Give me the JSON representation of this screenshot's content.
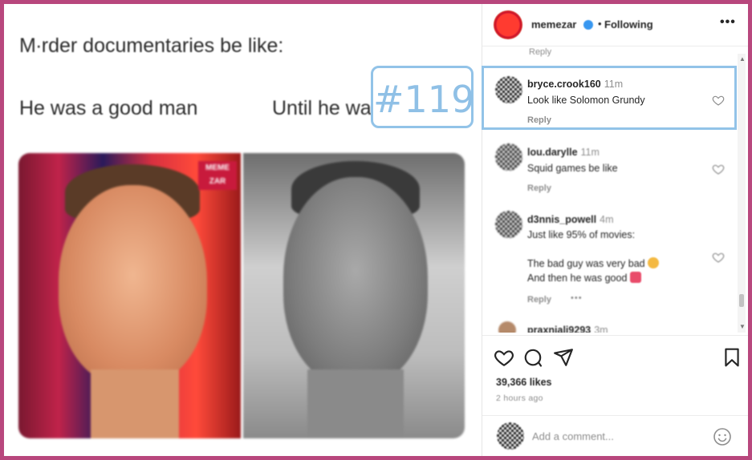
{
  "post": {
    "tweet_line1": "M∙rder documentaries be like:",
    "tweet_left": "He was a good man",
    "tweet_right": "Until he wa",
    "brand_tag_top": "MEME",
    "brand_tag_bottom": "ZAR"
  },
  "overlay": {
    "label": "#119"
  },
  "header": {
    "username": "memezar",
    "separator": "•",
    "follow_status": "Following",
    "more": "•••"
  },
  "comments": {
    "top_reply": "Reply",
    "items": [
      {
        "username": "bryce.crook160",
        "time": "11m",
        "text": [
          "Look like Solomon Grundy"
        ],
        "reply": "Reply"
      },
      {
        "username": "lou.darylle",
        "time": "11m",
        "text": [
          "Squid games be like"
        ],
        "reply": "Reply"
      },
      {
        "username": "d3nnis_powell",
        "time": "4m",
        "text": [
          "Just like 95% of movies:",
          "",
          "The bad guy was very bad",
          "And then he was good"
        ],
        "reply": "Reply",
        "more": "•••"
      },
      {
        "username": "praxnjali9293",
        "time": "3m"
      }
    ]
  },
  "stats": {
    "likes": "39,366 likes",
    "time_ago": "2 hours ago"
  },
  "add_comment": {
    "placeholder": "Add a comment..."
  },
  "colors": {
    "border_frame": "#b8477d",
    "highlight": "#92c3e8",
    "verified": "#3897f0"
  }
}
